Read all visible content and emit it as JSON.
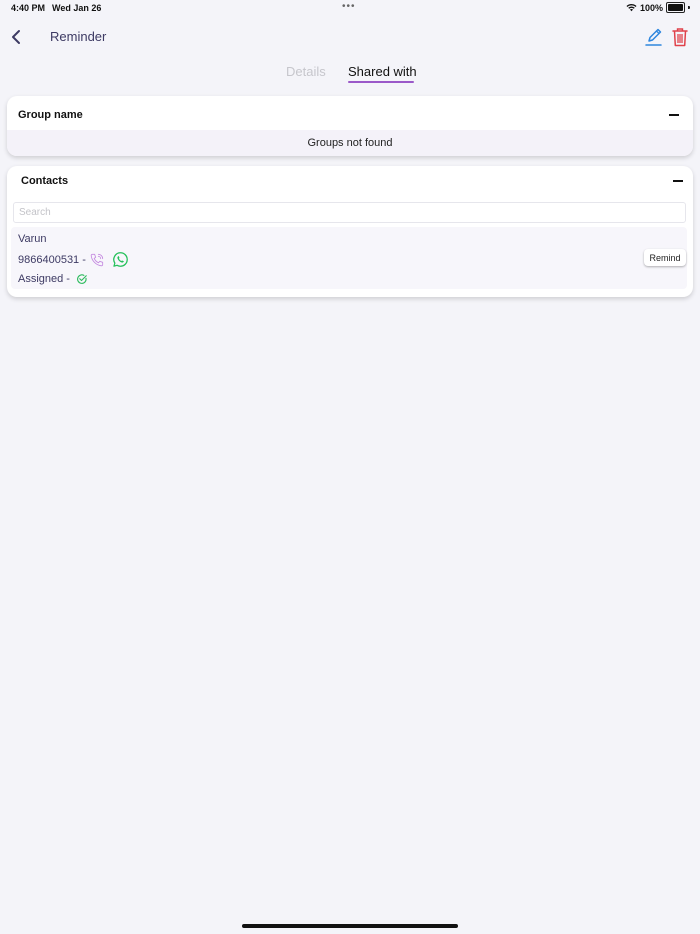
{
  "status_bar": {
    "time": "4:40 PM",
    "date": "Wed Jan 26",
    "dots": "•••",
    "battery_pct": "100%",
    "icons": [
      "wifi-icon",
      "battery-icon"
    ]
  },
  "nav": {
    "title": "Reminder",
    "icons": [
      "back-chevron-icon",
      "edit-pencil-icon",
      "trash-icon"
    ],
    "colors": {
      "title": "#3d3a63",
      "edit": "#2e86de",
      "delete": "#e0414a"
    }
  },
  "tabs": [
    {
      "label": "Details",
      "active": false
    },
    {
      "label": "Shared with",
      "active": true
    }
  ],
  "accent_color": "#9b59c9",
  "groups": {
    "title": "Group name",
    "empty_text": "Groups not found"
  },
  "contacts": {
    "title": "Contacts",
    "search_placeholder": "Search",
    "search_value": "",
    "items": [
      {
        "name": "Varun",
        "phone": "9866400531",
        "separator": "-",
        "assigned_label": "Assigned -",
        "remind_label": "Remind",
        "icons": [
          "phone-call-icon",
          "whatsapp-icon",
          "check-circle-icon"
        ]
      }
    ]
  }
}
